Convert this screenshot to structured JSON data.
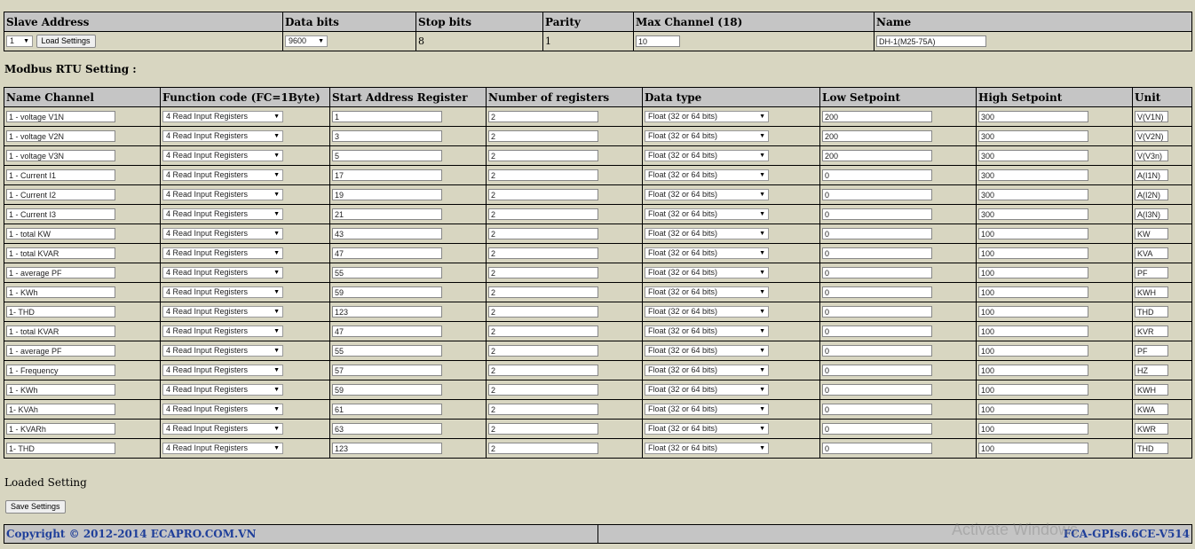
{
  "device": {
    "headers": [
      "Slave Address",
      "Data bits",
      "Stop bits",
      "Parity",
      "Max Channel (18)",
      "Name"
    ],
    "slave_address": "1",
    "load_button": "Load Settings",
    "data_bits": "9600",
    "stop_bits": "8",
    "parity": "1",
    "max_channel": "10",
    "name": "DH-1(M25-75A)"
  },
  "section_title": "Modbus RTU Setting :",
  "table": {
    "headers": [
      "Name Channel",
      "Function code (FC=1Byte)",
      "Start Address Register",
      "Number of registers",
      "Data type",
      "Low Setpoint",
      "High Setpoint",
      "Unit"
    ],
    "rows": [
      {
        "name": "1 - voltage V1N",
        "fc": "4 Read Input Registers",
        "start": "1",
        "count": "2",
        "dtype": "Float (32 or 64 bits)",
        "low": "200",
        "high": "300",
        "unit": "V(V1N)"
      },
      {
        "name": "1 - voltage V2N",
        "fc": "4 Read Input Registers",
        "start": "3",
        "count": "2",
        "dtype": "Float (32 or 64 bits)",
        "low": "200",
        "high": "300",
        "unit": "V(V2N)"
      },
      {
        "name": "1 - voltage V3N",
        "fc": "4 Read Input Registers",
        "start": "5",
        "count": "2",
        "dtype": "Float (32 or 64 bits)",
        "low": "200",
        "high": "300",
        "unit": "V(V3n)"
      },
      {
        "name": "1 - Current I1",
        "fc": "4 Read Input Registers",
        "start": "17",
        "count": "2",
        "dtype": "Float (32 or 64 bits)",
        "low": "0",
        "high": "300",
        "unit": "A(I1N)"
      },
      {
        "name": "1 - Current I2",
        "fc": "4 Read Input Registers",
        "start": "19",
        "count": "2",
        "dtype": "Float (32 or 64 bits)",
        "low": "0",
        "high": "300",
        "unit": "A(I2N)"
      },
      {
        "name": "1 - Current I3",
        "fc": "4 Read Input Registers",
        "start": "21",
        "count": "2",
        "dtype": "Float (32 or 64 bits)",
        "low": "0",
        "high": "300",
        "unit": "A(I3N)"
      },
      {
        "name": "1 - total KW",
        "fc": "4 Read Input Registers",
        "start": "43",
        "count": "2",
        "dtype": "Float (32 or 64 bits)",
        "low": "0",
        "high": "100",
        "unit": "KW"
      },
      {
        "name": "1 - total KVAR",
        "fc": "4 Read Input Registers",
        "start": "47",
        "count": "2",
        "dtype": "Float (32 or 64 bits)",
        "low": "0",
        "high": "100",
        "unit": "KVA"
      },
      {
        "name": "1 - average PF",
        "fc": "4 Read Input Registers",
        "start": "55",
        "count": "2",
        "dtype": "Float (32 or 64 bits)",
        "low": "0",
        "high": "100",
        "unit": "PF"
      },
      {
        "name": "1 - KWh",
        "fc": "4 Read Input Registers",
        "start": "59",
        "count": "2",
        "dtype": "Float (32 or 64 bits)",
        "low": "0",
        "high": "100",
        "unit": "KWH"
      },
      {
        "name": "1- THD",
        "fc": "4 Read Input Registers",
        "start": "123",
        "count": "2",
        "dtype": "Float (32 or 64 bits)",
        "low": "0",
        "high": "100",
        "unit": "THD"
      },
      {
        "name": "1 - total KVAR",
        "fc": "4 Read Input Registers",
        "start": "47",
        "count": "2",
        "dtype": "Float (32 or 64 bits)",
        "low": "0",
        "high": "100",
        "unit": "KVR"
      },
      {
        "name": "1 - average PF",
        "fc": "4 Read Input Registers",
        "start": "55",
        "count": "2",
        "dtype": "Float (32 or 64 bits)",
        "low": "0",
        "high": "100",
        "unit": "PF"
      },
      {
        "name": "1 - Frequency",
        "fc": "4 Read Input Registers",
        "start": "57",
        "count": "2",
        "dtype": "Float (32 or 64 bits)",
        "low": "0",
        "high": "100",
        "unit": "HZ"
      },
      {
        "name": "1 - KWh",
        "fc": "4 Read Input Registers",
        "start": "59",
        "count": "2",
        "dtype": "Float (32 or 64 bits)",
        "low": "0",
        "high": "100",
        "unit": "KWH"
      },
      {
        "name": "1- KVAh",
        "fc": "4 Read Input Registers",
        "start": "61",
        "count": "2",
        "dtype": "Float (32 or 64 bits)",
        "low": "0",
        "high": "100",
        "unit": "KWA"
      },
      {
        "name": "1 - KVARh",
        "fc": "4 Read Input Registers",
        "start": "63",
        "count": "2",
        "dtype": "Float (32 or 64 bits)",
        "low": "0",
        "high": "100",
        "unit": "KWR"
      },
      {
        "name": "1- THD",
        "fc": "4 Read Input Registers",
        "start": "123",
        "count": "2",
        "dtype": "Float (32 or 64 bits)",
        "low": "0",
        "high": "100",
        "unit": "THD"
      }
    ]
  },
  "status_text": "Loaded Setting",
  "save_button": "Save Settings",
  "footer": {
    "copyright": "Copyright © 2012-2014 ECAPRO.COM.VN",
    "version": "FCA-GPIs6.6CE-V514"
  },
  "watermark": "Activate Windows",
  "icons": {
    "dropdown": "chevron-down-icon"
  },
  "colors": {
    "background": "#d8d6c1",
    "header_bg": "#c5c5c5",
    "footer_text": "#1f3f9a"
  }
}
